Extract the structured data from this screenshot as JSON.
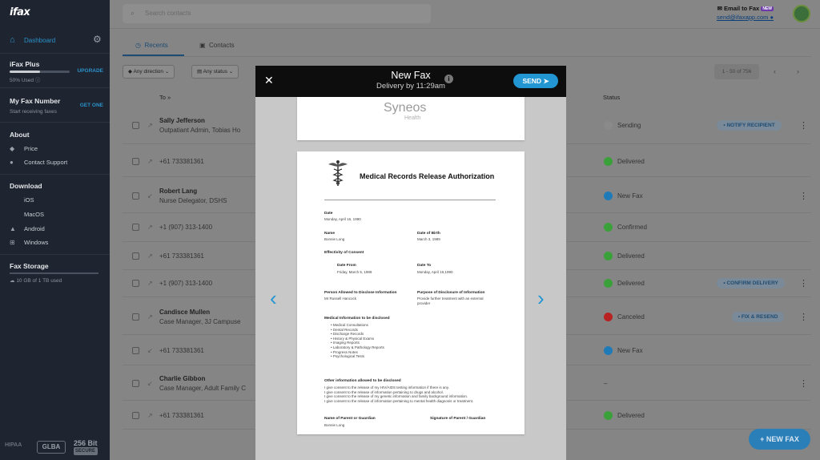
{
  "app": {
    "logo": "ifax"
  },
  "sidebar": {
    "dashboard_label": "Dashboard",
    "plan": {
      "title": "iFax Plus",
      "upgrade": "UPGRADE",
      "usage": "50% Used",
      "usage_fraction": 0.5
    },
    "fax_number": {
      "title": "My Fax Number",
      "get_one": "GET ONE",
      "subtitle": "Start receiving faxes"
    },
    "about": {
      "title": "About",
      "items": [
        {
          "label": "Price",
          "icon": "tag-icon"
        },
        {
          "label": "Contact Support",
          "icon": "person-icon"
        }
      ]
    },
    "download": {
      "title": "Download",
      "items": [
        {
          "label": "iOS",
          "icon": "apple-icon"
        },
        {
          "label": "MacOS",
          "icon": "apple-icon"
        },
        {
          "label": "Android",
          "icon": "android-icon"
        },
        {
          "label": "Windows",
          "icon": "windows-icon"
        }
      ]
    },
    "storage": {
      "title": "Fax Storage",
      "used": "10 GB of 1 TB used",
      "fraction": 0.01
    },
    "badges": {
      "hipaa": "HIPAA",
      "glba": "GLBA",
      "bit": "256 Bit",
      "secure": "SECURE"
    }
  },
  "topbar": {
    "search_placeholder": "Search contacts",
    "email_to_fax": "Email to Fax",
    "new_badge": "NEW",
    "email": "send@ifaxapp.com"
  },
  "tabs": [
    {
      "label": "Recents",
      "icon": "clock-icon"
    },
    {
      "label": "Contacts",
      "icon": "contacts-icon"
    }
  ],
  "filters": {
    "direction": "Any direction",
    "status": "Any status"
  },
  "pager": {
    "range": "1 - 50 of 756"
  },
  "table": {
    "headers": {
      "to": "To",
      "status": "Status"
    },
    "rows": [
      {
        "name": "Sally Jefferson",
        "sub": "Outpatiant Admin, Tobias Ho",
        "status": "Sending",
        "dot": "#8a8a8a",
        "action": "NOTIFY RECIPIENT",
        "action_icon": "mail-icon"
      },
      {
        "name": "",
        "sub": "+61 733381361",
        "status": "Delivered",
        "dot": "#3aa03a",
        "action": ""
      },
      {
        "name": "Robert Lang",
        "sub": "Nurse Delegator, DSHS",
        "status": "New Fax",
        "dot": "#1f7ab8",
        "action": ""
      },
      {
        "name": "",
        "sub": "+1 (907) 313-1400",
        "status": "Confirmed",
        "dot": "#3aa03a",
        "action": ""
      },
      {
        "name": "",
        "sub": "+61 733381361",
        "status": "Delivered",
        "dot": "#3aa03a",
        "action": ""
      },
      {
        "name": "",
        "sub": "+1 (907) 313-1400",
        "status": "Delivered",
        "dot": "#3aa03a",
        "action": "CONFIRM DELIVERY",
        "action_icon": "check-icon"
      },
      {
        "name": "Candisce Mullen",
        "sub": "Case Manager, 3J Campuse",
        "status": "Canceled",
        "dot": "#b82222",
        "action": "FIX & RESEND",
        "action_icon": "wrench-icon"
      },
      {
        "name": "",
        "sub": "+61 733381361",
        "status": "New Fax",
        "dot": "#1f7ab8",
        "action": ""
      },
      {
        "name": "Charlie Gibbon",
        "sub": "Case Manager, Adult Family C",
        "status": "–",
        "dot": "",
        "action": ""
      },
      {
        "name": "",
        "sub": "+61 733381361",
        "status": "Delivered",
        "dot": "#3aa03a",
        "action": ""
      }
    ]
  },
  "new_fax_button": "+ NEW FAX",
  "modal": {
    "title": "New Fax",
    "subtitle": "Delivery by 11:29am",
    "info": "i",
    "send": "SEND",
    "page1_logo": "Syneos",
    "page1_logo_sub": "Health",
    "document": {
      "title": "Medical Records Release Authorization",
      "date_label": "Date",
      "date_value": "Monday, April 16, 1990",
      "name_label": "Name",
      "name_value": "Bonnie Long",
      "dob_label": "Date of Birth",
      "dob_value": "March 3, 1989",
      "effectivity_label": "Effectivity of Consent",
      "from_label": "Date From",
      "from_value": "Friday, March 5, 1989",
      "to_label": "Date To",
      "to_value": "Monday, April 19,1990",
      "allowed_label": "Person Allowed to Disclose Information",
      "allowed_value": "Mr Russell Hancock",
      "purpose_label": "Purpose of Disclosure of Information",
      "purpose_value": "Provide further treatment with an external provider",
      "medinfo_label": "Medical Information to be disclosed",
      "medinfo_items": [
        "Medical Consultations",
        "Dental Records",
        "Discharge Records",
        "History & Physical Exams",
        "Imaging Reports",
        "Laboratory & Pathology Reports",
        "Progress Notes",
        "Psychological Tests"
      ],
      "other_label": "Other information allowed to be disclosed",
      "other_lines": [
        "I give consent to the release of my HIV/AIDS testing information if there is any.",
        "I give consent to the release of information pertaining to drugs and alcohol.",
        "I give consent to the release of my genetic information and family background information.",
        "I give consent to the release of information pertaining to mental health diagnosis or treatment."
      ],
      "parent_label": "Name of Parent or Guardian",
      "parent_value": "Bonnie Long",
      "signature_label": "Signature of Parent / Guardian"
    }
  }
}
